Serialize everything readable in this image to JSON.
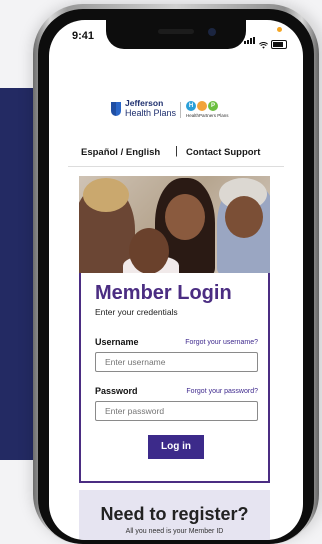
{
  "status_bar": {
    "time": "9:41"
  },
  "logos": {
    "jefferson_name": "Jefferson",
    "jefferson_sub": "Health Plans",
    "hp_letters": [
      "H",
      "P"
    ],
    "hp_text": "HealthPartners Plans"
  },
  "nav": {
    "language": "Español / English",
    "separator": "|",
    "support": "Contact Support"
  },
  "login": {
    "title": "Member Login",
    "subtitle": "Enter your credentials",
    "username_label": "Username",
    "username_forgot": "Forgot your username?",
    "username_placeholder": "Enter username",
    "password_label": "Password",
    "password_forgot": "Forgot your password?",
    "password_placeholder": "Enter password",
    "button": "Log in"
  },
  "register": {
    "title": "Need to register?",
    "subtitle": "All you need is your Member ID"
  },
  "colors": {
    "navy_band": "#232a63",
    "brand_purple": "#4b2d82",
    "button": "#3c2a8a",
    "register_bg": "#e6e4f1",
    "hp_blue": "#2a9fd8",
    "hp_green": "#6cbf3f"
  }
}
